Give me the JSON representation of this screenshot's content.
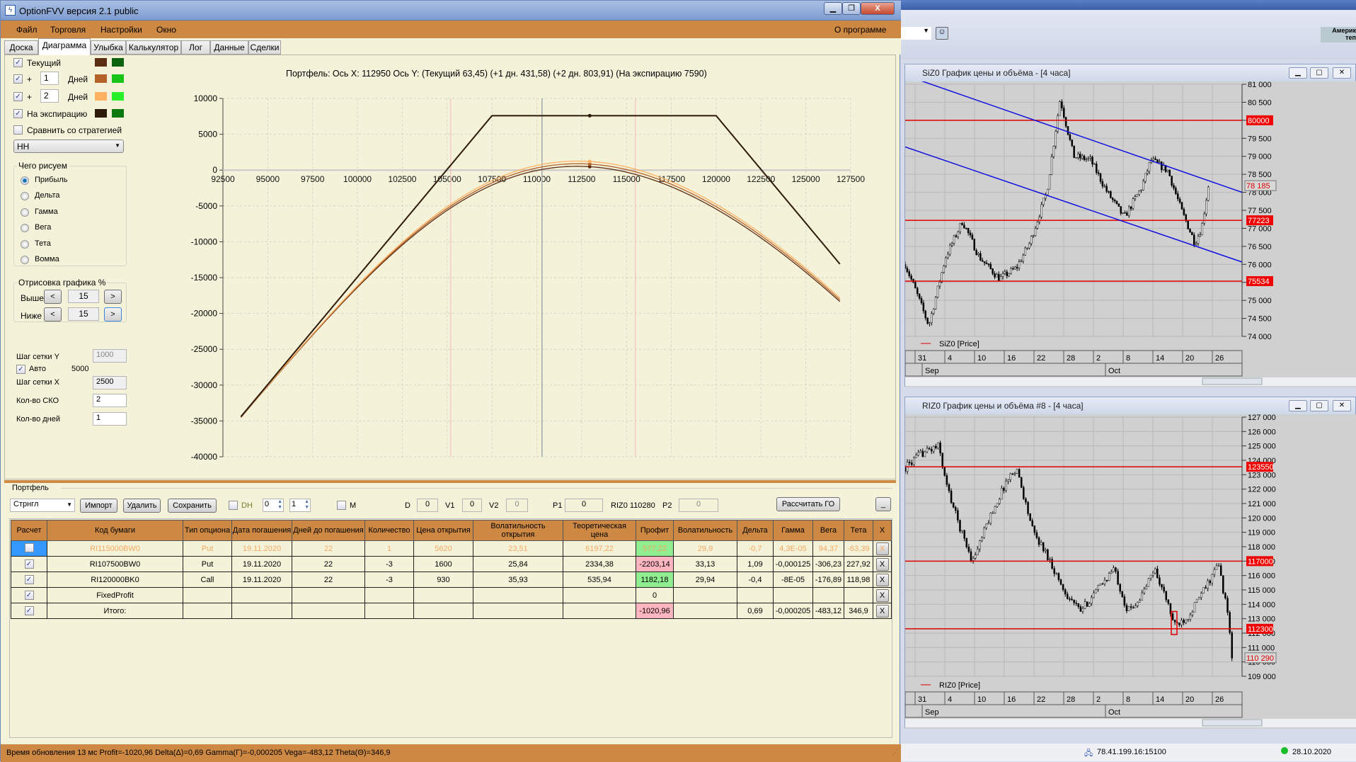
{
  "window": {
    "title": "OptionFVV версия 2.1 public",
    "min": "▁",
    "max": "❐",
    "close": "X"
  },
  "menu": {
    "items": [
      "Файл",
      "Торговля",
      "Настройки",
      "Окно"
    ],
    "about": "О программе"
  },
  "tabs": [
    "Доска",
    "Диаграмма",
    "Улыбка",
    "Калькулятор",
    "Лог",
    "Данные",
    "Сделки"
  ],
  "left": {
    "current": {
      "label": "Текущий",
      "checked": true,
      "colors": [
        "#5c2e14",
        "#0d6410"
      ]
    },
    "plus1": {
      "plus": "+",
      "value": "1",
      "unit": "Дней",
      "checked": true,
      "colors": [
        "#b5612a",
        "#19c419"
      ]
    },
    "plus2": {
      "plus": "+",
      "value": "2",
      "unit": "Дней",
      "checked": true,
      "colors": [
        "#ffb060",
        "#28f028"
      ]
    },
    "expiry": {
      "label": "На экспирацию",
      "checked": true,
      "colors": [
        "#2e1a08",
        "#087a10"
      ]
    },
    "compare": {
      "label": "Сравнить со стратегией",
      "checked": false
    },
    "strategy_select": "HH",
    "draw_group": {
      "title": "Чего рисуем",
      "options": [
        "Прибыль",
        "Дельта",
        "Гамма",
        "Вега",
        "Тета",
        "Вомма"
      ],
      "selected": "Прибыль"
    },
    "range_group": {
      "title": "Отрисовка графика %",
      "above_label": "Выше",
      "above": "15",
      "below_label": "Ниже",
      "below": "15",
      "dec": "<",
      "inc": ">"
    },
    "grid_y_label": "Шаг сетки Y",
    "grid_y": "1000",
    "auto_label": "Авто",
    "auto_checked": true,
    "auto_value": "5000",
    "grid_x_label": "Шаг сетки X",
    "grid_x": "2500",
    "sko_label": "Кол-во СКО",
    "sko": "2",
    "days_label": "Кол-во дней",
    "days": "1"
  },
  "chart_header": "Портфель: Ось X: 112950 Ось Y:  (Текущий 63,45)  (+1 дн. 431,58)  (+2 дн. 803,91)  (На экспирацию 7590)",
  "chart_data": {
    "type": "line",
    "title": "Портфель: Ось X: 112950 Ось Y",
    "xlim": [
      92500,
      127500
    ],
    "ylim": [
      -40000,
      10000
    ],
    "xticks": [
      92500,
      95000,
      97500,
      100000,
      102500,
      105000,
      107500,
      110000,
      112500,
      115000,
      117500,
      120000,
      122500,
      125000,
      127500
    ],
    "yticks": [
      10000,
      5000,
      0,
      -5000,
      -10000,
      -15000,
      -20000,
      -25000,
      -30000,
      -35000,
      -40000
    ],
    "curve_x_range": [
      93500,
      126900
    ],
    "cursor_x": 112950,
    "underlying_price_line": 110290,
    "sko_lines": [
      105200,
      115500
    ],
    "legs": [
      {
        "strike": 107500,
        "type": "put",
        "qty": -3,
        "open": 1600,
        "vol": 25.84
      },
      {
        "strike": 120000,
        "type": "call",
        "qty": -3,
        "open": 930,
        "vol": 35.93
      }
    ],
    "days_to_expiry": 22,
    "series": [
      {
        "name": "Текущий",
        "days_offset": 0,
        "color": "#5c2e14"
      },
      {
        "name": "+1 дн.",
        "days_offset": 1,
        "color": "#b5612a"
      },
      {
        "name": "+2 дн.",
        "days_offset": 2,
        "color": "#ffb060"
      },
      {
        "name": "На экспирацию",
        "color": "#2e1a08",
        "points": [
          [
            93500,
            -34410
          ],
          [
            107500,
            7590
          ],
          [
            120000,
            7590
          ],
          [
            126900,
            -13110
          ]
        ]
      }
    ]
  },
  "portfolio": {
    "title": "Портфель",
    "combo": "Стрнгл",
    "import": "Импорт",
    "delete": "Удалить",
    "save": "Сохранить",
    "dh_label": "DH",
    "spin1": "0",
    "spin2": "1",
    "m_label": "M",
    "d_label": "D",
    "d": "0",
    "v1_label": "V1",
    "v1": "0",
    "v2_label": "V2",
    "v2": "0",
    "p1_label": "P1",
    "p1": "0",
    "riz_label": "RIZ0 110280",
    "p2_label": "P2",
    "p2": "0",
    "calc_go": "Рассчитать ГО",
    "min_btn": "_"
  },
  "table": {
    "headers": [
      "Расчет",
      "Код бумаги",
      "Тип опциона",
      "Дата погашения",
      "Дней до погашения",
      "Количество",
      "Цена открытия",
      "Волатильность открытия",
      "Теоретическая цена",
      "Профит",
      "Волатильность",
      "Дельта",
      "Гамма",
      "Вега",
      "Тета",
      "X"
    ],
    "rows": [
      {
        "checked": false,
        "cells": [
          "RI115000BW0",
          "Put",
          "19.11.2020",
          "22",
          "1",
          "5620",
          "23,51",
          "6197,22",
          "577,22",
          "29,9",
          "-0,7",
          "4,3E-05",
          "94,37",
          "-63,39"
        ],
        "profit_state": "pos",
        "off": true
      },
      {
        "checked": true,
        "cells": [
          "RI107500BW0",
          "Put",
          "19.11.2020",
          "22",
          "-3",
          "1600",
          "25,84",
          "2334,38",
          "-2203,14",
          "33,13",
          "1,09",
          "-0,000125",
          "-306,23",
          "227,92"
        ],
        "profit_state": "neg"
      },
      {
        "checked": true,
        "cells": [
          "RI120000BK0",
          "Call",
          "19.11.2020",
          "22",
          "-3",
          "930",
          "35,93",
          "535,94",
          "1182,18",
          "29,94",
          "-0,4",
          "-8E-05",
          "-176,89",
          "118,98"
        ],
        "profit_state": "pos"
      },
      {
        "checked": true,
        "cells": [
          "FixedProfit",
          "",
          "",
          "",
          "",
          "",
          "",
          "",
          "0",
          "",
          "",
          "",
          "",
          ""
        ],
        "profit_state": ""
      },
      {
        "checked": true,
        "cells": [
          "Итого:",
          "",
          "",
          "",
          "",
          "",
          "",
          "",
          "-1020,96",
          "",
          "0,69",
          "-0,000205",
          "-483,12",
          "346,9"
        ],
        "profit_state": "neg"
      }
    ],
    "remove": "X"
  },
  "status": "Время обновления 13 мс  Profit=-1020,96 Delta(Δ)=0,69 Gamma(Γ)=-0,000205 Vega=-483,12 Theta(Θ)=346,9",
  "right": {
    "toolbar_label1": "Америк",
    "toolbar_label2": "теп",
    "siz": {
      "title": "SiZ0 График цены и объёма - [4 часа]",
      "legend": "SiZ0 [Price]",
      "yticks": [
        "81 000",
        "80 500",
        "80 000",
        "79 500",
        "79 000",
        "78 500",
        "78 000",
        "77 500",
        "77 000",
        "76 500",
        "76 000",
        "75 500",
        "75 000",
        "74 500",
        "74 000"
      ],
      "ymax": 81000,
      "ymin": 74000,
      "levels": [
        "80000",
        "77223",
        "75534"
      ],
      "last": "78 185",
      "days": [
        "31",
        "4",
        "10",
        "16",
        "22",
        "28",
        "2",
        "8",
        "14",
        "20",
        "26"
      ],
      "months": [
        "Sep",
        "Oct"
      ],
      "path": [
        [
          0,
          76000
        ],
        [
          0.03,
          75300
        ],
        [
          0.07,
          74300
        ],
        [
          0.12,
          76200
        ],
        [
          0.17,
          77200
        ],
        [
          0.22,
          76200
        ],
        [
          0.28,
          75600
        ],
        [
          0.33,
          75900
        ],
        [
          0.37,
          76600
        ],
        [
          0.42,
          78000
        ],
        [
          0.46,
          80600
        ],
        [
          0.5,
          79000
        ],
        [
          0.55,
          78900
        ],
        [
          0.6,
          78000
        ],
        [
          0.65,
          77300
        ],
        [
          0.7,
          78100
        ],
        [
          0.73,
          78900
        ],
        [
          0.78,
          78600
        ],
        [
          0.82,
          77500
        ],
        [
          0.86,
          76600
        ],
        [
          0.88,
          77000
        ],
        [
          0.9,
          78185
        ]
      ],
      "trend_upper": [
        [
          0,
          81250
        ],
        [
          1,
          78000
        ]
      ],
      "trend_lower": [
        [
          0,
          79260
        ],
        [
          1,
          76065
        ]
      ]
    },
    "riz": {
      "title": "RIZ0 График цены и объёма #8 - [4 часа]",
      "legend": "RIZ0 [Price]",
      "yticks": [
        "127 000",
        "126 000",
        "125 000",
        "124 000",
        "123 000",
        "122 000",
        "121 000",
        "120 000",
        "119 000",
        "118 000",
        "117 000",
        "116 000",
        "115 000",
        "114 000",
        "113 000",
        "112 000",
        "111 000",
        "110 000",
        "109 000"
      ],
      "ymax": 127000,
      "ymin": 109000,
      "levels": [
        "123550",
        "117000",
        "112300"
      ],
      "last": "110 290",
      "days": [
        "31",
        "4",
        "10",
        "16",
        "22",
        "28",
        "2",
        "8",
        "14",
        "20",
        "26"
      ],
      "months": [
        "Sep",
        "Oct"
      ],
      "path": [
        [
          0,
          123500
        ],
        [
          0.05,
          124500
        ],
        [
          0.1,
          125000
        ],
        [
          0.12,
          122500
        ],
        [
          0.16,
          119500
        ],
        [
          0.2,
          117000
        ],
        [
          0.25,
          120000
        ],
        [
          0.3,
          122500
        ],
        [
          0.33,
          123500
        ],
        [
          0.38,
          119000
        ],
        [
          0.42,
          117500
        ],
        [
          0.47,
          115000
        ],
        [
          0.52,
          113500
        ],
        [
          0.57,
          115000
        ],
        [
          0.62,
          116500
        ],
        [
          0.66,
          113500
        ],
        [
          0.7,
          114500
        ],
        [
          0.74,
          116500
        ],
        [
          0.78,
          114000
        ],
        [
          0.8,
          112500
        ],
        [
          0.84,
          113200
        ],
        [
          0.9,
          115500
        ],
        [
          0.93,
          116800
        ],
        [
          0.96,
          113000
        ],
        [
          0.97,
          110290
        ]
      ]
    },
    "ip": "78.41.199.16:15100",
    "date": "28.10.2020"
  }
}
